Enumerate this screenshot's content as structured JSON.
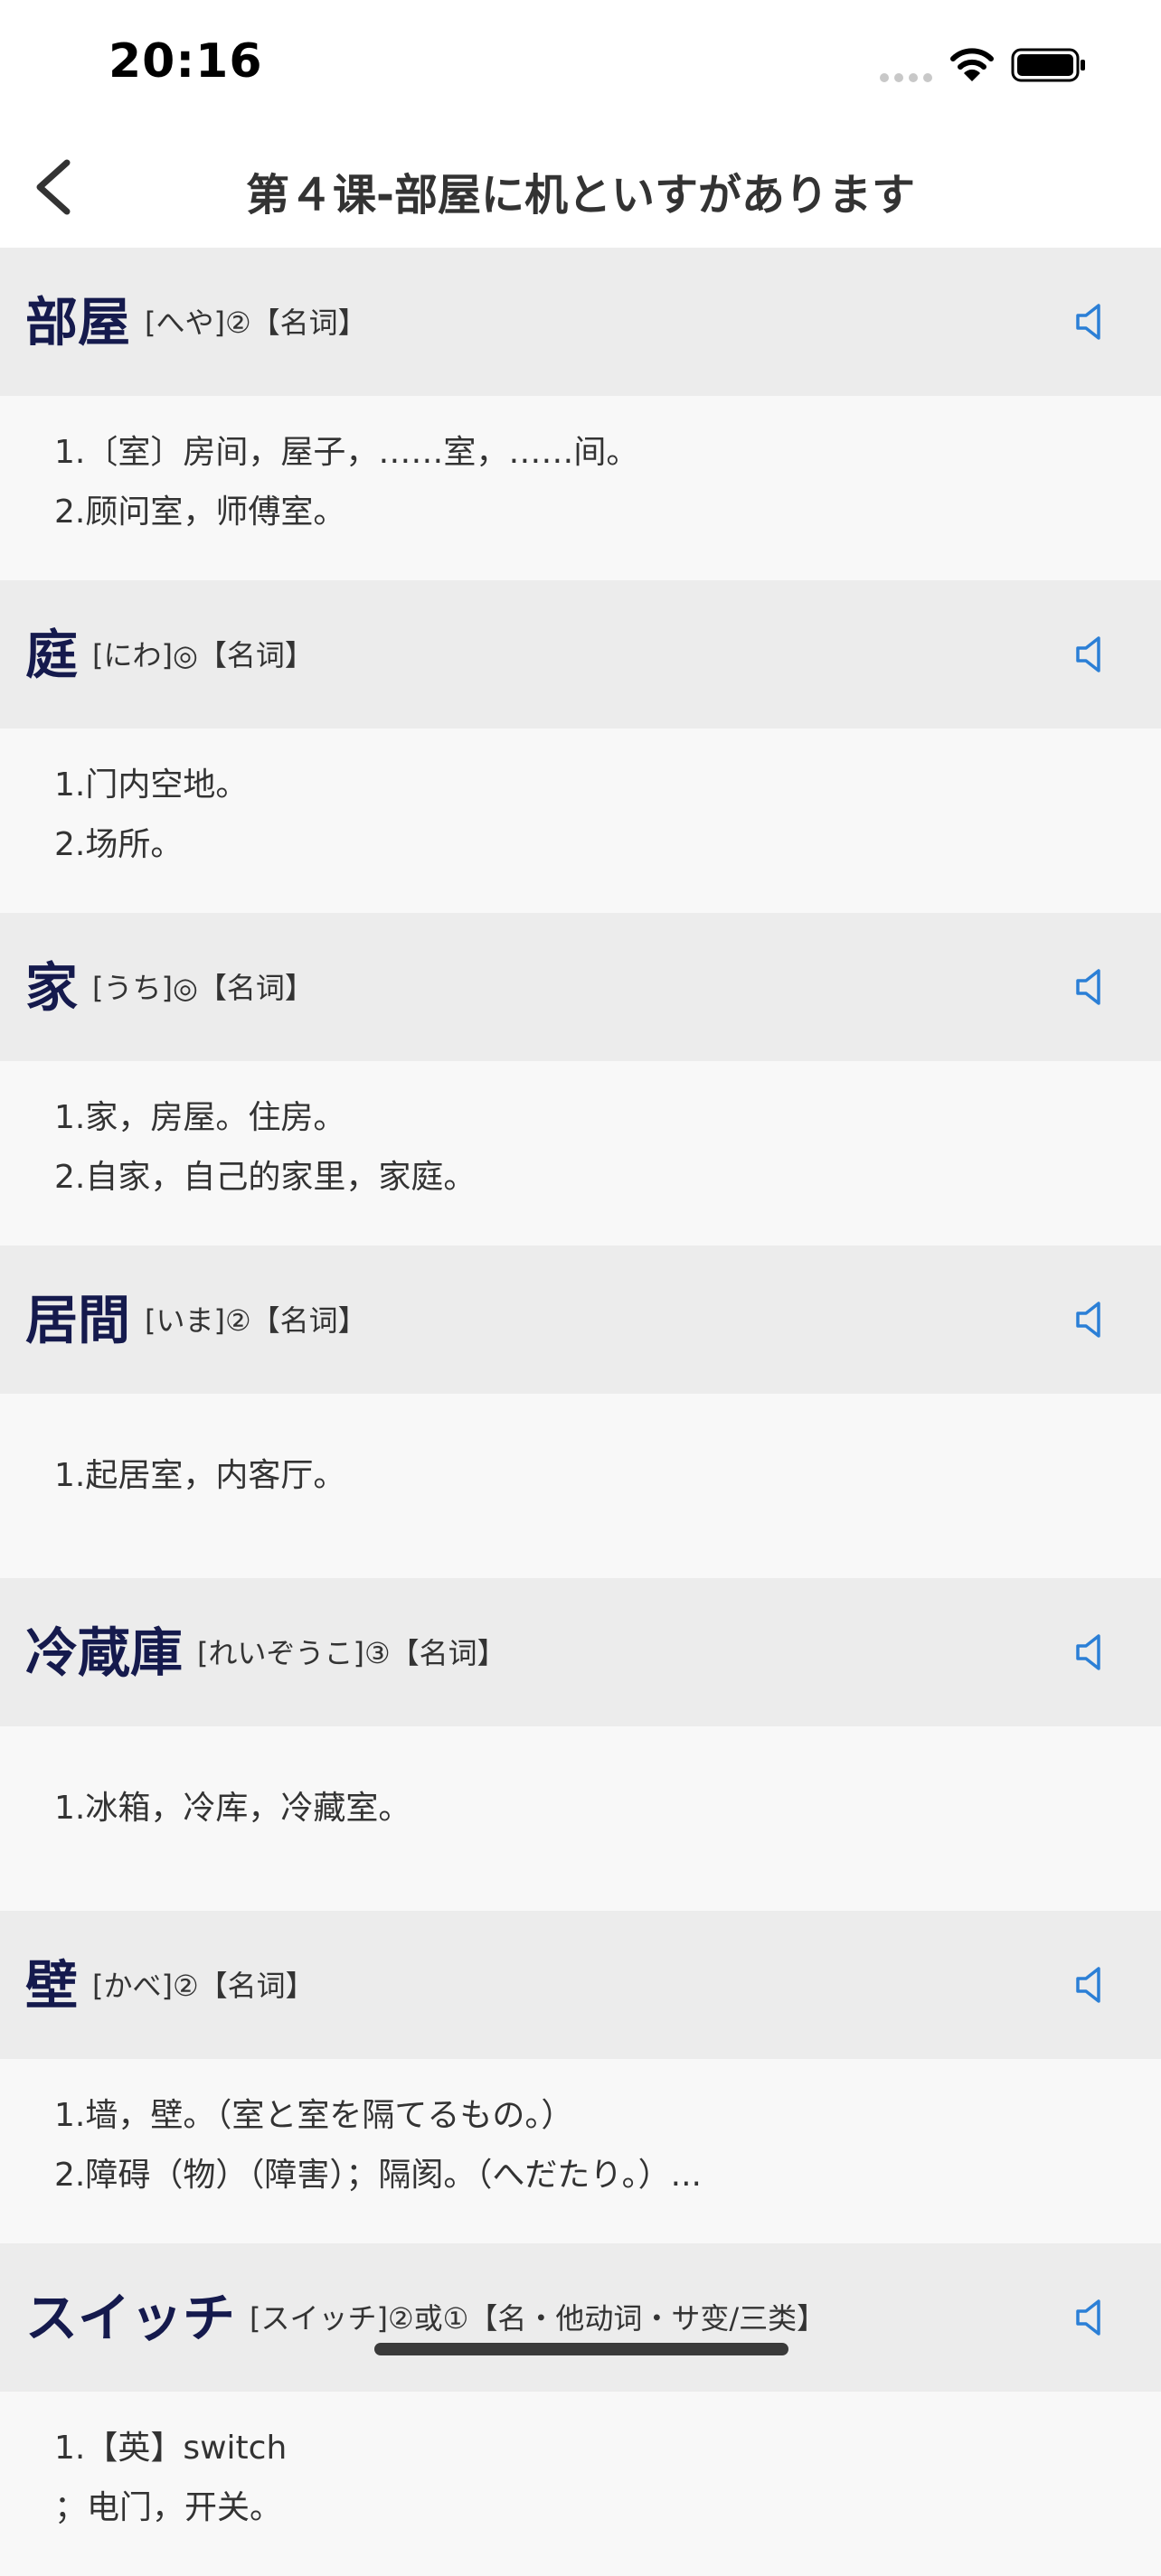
{
  "status_bar": {
    "time": "20:16"
  },
  "nav": {
    "title": "第４课-部屋に机といすがあります"
  },
  "entries": [
    {
      "word": "部屋",
      "reading": "[へや]②【名词】",
      "defs": [
        "1.〔室〕房间，屋子，……室，……间。",
        "2.顾问室，师傅室。"
      ]
    },
    {
      "word": "庭",
      "reading": "[にわ]◎【名词】",
      "defs": [
        "1.门内空地。",
        "2.场所。"
      ]
    },
    {
      "word": "家",
      "reading": "[うち]◎【名词】",
      "defs": [
        "1.家，房屋。住房。",
        "2.自家，自己的家里，家庭。"
      ]
    },
    {
      "word": "居間",
      "reading": "[いま]②【名词】",
      "defs": [
        "1.起居室，内客厅。"
      ]
    },
    {
      "word": "冷蔵庫",
      "reading": "[れいぞうこ]③【名词】",
      "defs": [
        "1.冰箱，冷库，冷藏室。"
      ]
    },
    {
      "word": "壁",
      "reading": "[かべ]②【名词】",
      "defs": [
        "1.墙，壁。（室と室を隔てるもの。）",
        "2.障碍（物）（障害）；隔阂。（へだたり。）..."
      ]
    },
    {
      "word": "スイッチ",
      "reading": "[スイッチ]②或①【名・他动词・サ变/三类】",
      "defs": [
        "1.【英】switch",
        "；电门，开关。"
      ]
    }
  ],
  "colors": {
    "word": "#151a4d",
    "accent": "#2b7fd6",
    "head_bg": "#ececec",
    "body_bg": "#f8f8f8"
  },
  "icons": {
    "back": "chevron-left-icon",
    "speaker": "speaker-icon",
    "wifi": "wifi-icon",
    "battery": "battery-icon",
    "signal": "signal-icon"
  }
}
